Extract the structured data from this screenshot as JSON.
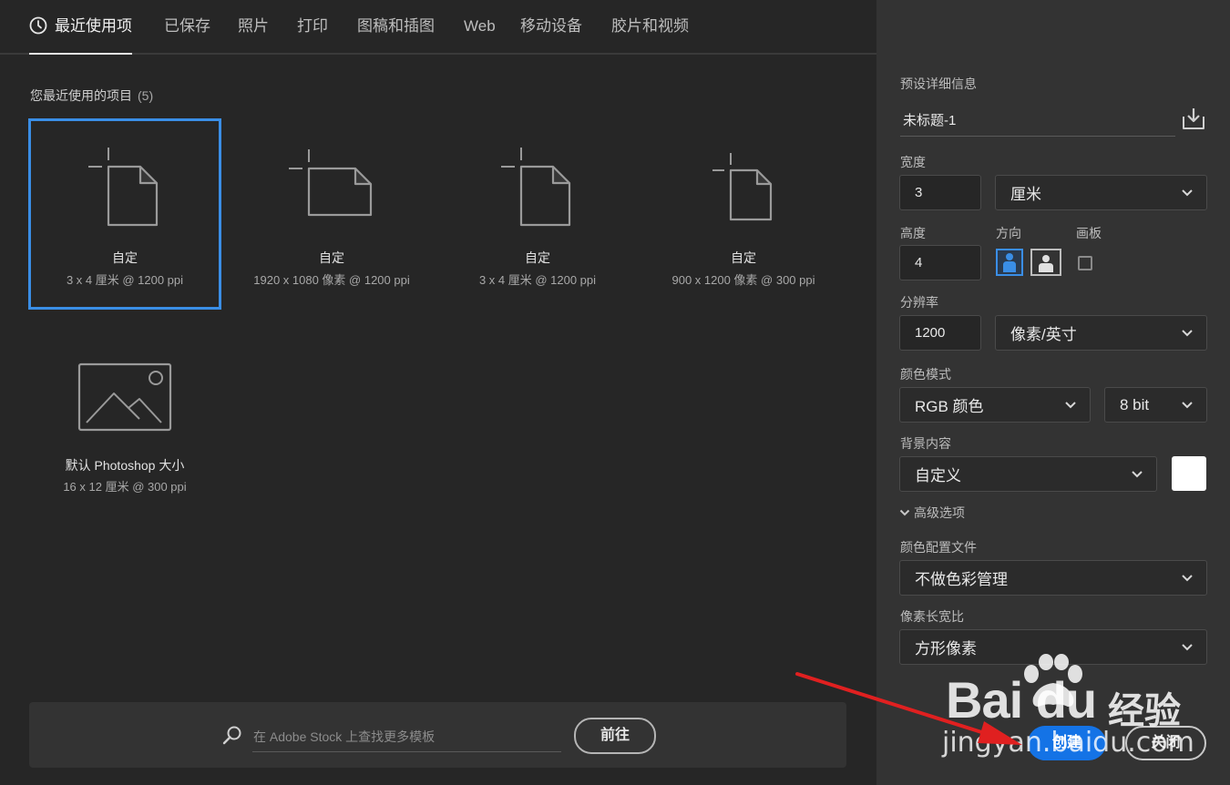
{
  "tabs": [
    {
      "label": "最近使用项",
      "active": true
    },
    {
      "label": "已保存"
    },
    {
      "label": "照片"
    },
    {
      "label": "打印"
    },
    {
      "label": "图稿和插图"
    },
    {
      "label": "Web"
    },
    {
      "label": "移动设备"
    },
    {
      "label": "胶片和视频"
    }
  ],
  "recent": {
    "title": "您最近使用的项目",
    "count": "(5)",
    "items": [
      {
        "name": "自定",
        "spec": "3 x 4 厘米 @ 1200 ppi",
        "orientation": "portrait",
        "selected": true
      },
      {
        "name": "自定",
        "spec": "1920 x 1080 像素 @ 1200 ppi",
        "orientation": "landscape"
      },
      {
        "name": "自定",
        "spec": "3 x 4 厘米 @ 1200 ppi",
        "orientation": "portrait"
      },
      {
        "name": "自定",
        "spec": "900 x 1200 像素 @ 300 ppi",
        "orientation": "portrait"
      },
      {
        "name": "默认 Photoshop 大小",
        "spec": "16 x 12 厘米 @ 300 ppi",
        "icon": "image-placeholder-icon"
      }
    ]
  },
  "stock": {
    "placeholder": "在 Adobe Stock 上查找更多模板",
    "go_label": "前往"
  },
  "panel": {
    "title": "预设详细信息",
    "preset_name": "未标题-1",
    "width_label": "宽度",
    "width_value": "3",
    "width_unit": "厘米",
    "height_label": "高度",
    "height_value": "4",
    "orientation_label": "方向",
    "artboard_label": "画板",
    "resolution_label": "分辨率",
    "resolution_value": "1200",
    "resolution_unit": "像素/英寸",
    "color_mode_label": "颜色模式",
    "color_mode": "RGB 颜色",
    "bit_depth": "8 bit",
    "background_label": "背景内容",
    "background_value": "自定义",
    "background_color": "#ffffff",
    "advanced_label": "高级选项",
    "color_profile_label": "颜色配置文件",
    "color_profile": "不做色彩管理",
    "pixel_ratio_label": "像素长宽比",
    "pixel_ratio": "方形像素",
    "create_label": "创建",
    "close_label": "关闭"
  },
  "colors": {
    "accent": "#1473e6",
    "selection": "#3a8ee6",
    "annotation_arrow": "#e02020"
  },
  "watermark": {
    "brand": "Bai du",
    "brand_cn": "经验",
    "url": "jingyan.baidu.com"
  }
}
